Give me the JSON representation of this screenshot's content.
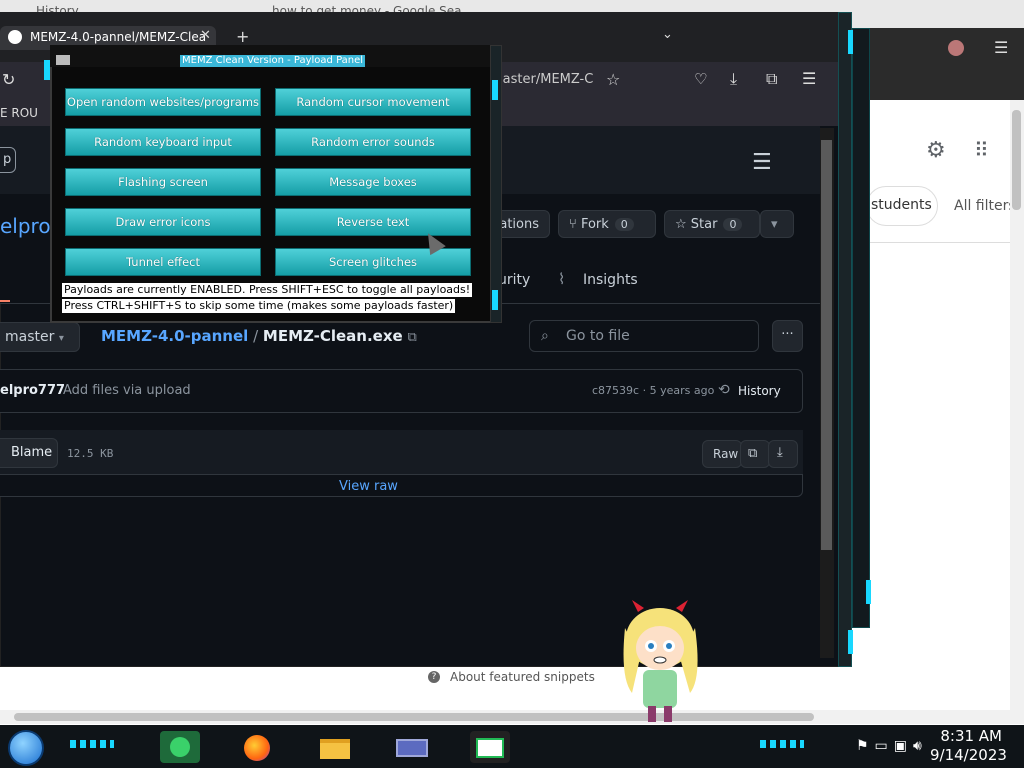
{
  "bg_browser": {
    "tabs": [
      "History",
      "how to get money - Google Search"
    ],
    "chips": [
      "students"
    ],
    "all_filters": "All filters",
    "about_snippets": "About featured snippets"
  },
  "gh": {
    "tab_title": "MEMZ-4.0-pannel/MEMZ-Clea",
    "url": "master/MEMZ-C",
    "bookmark": "E ROU",
    "repo_name_fragment": "elpro",
    "buttons": {
      "notifications": "cations",
      "fork": "Fork",
      "fork_count": "0",
      "star": "Star",
      "star_count": "0"
    },
    "tabs": [
      "urity",
      "Insights"
    ],
    "branch": "master",
    "path_repo": "MEMZ-4.0-pannel",
    "path_sep": "/",
    "path_file": "MEMZ-Clean.exe",
    "go_to_file": "Go to file",
    "commit_author": "elpro777",
    "commit_msg": "Add files via upload",
    "commit_hash": "c87539c · 5 years ago",
    "history": "History",
    "blame": "Blame",
    "size": "12.5 KB",
    "raw": "Raw",
    "view_raw": "View raw",
    "left_button_fragment": "p"
  },
  "memz": {
    "title": "MEMZ Clean Version - Payload Panel",
    "buttons": [
      "Open random websites/programs",
      "Random cursor movement",
      "Random keyboard input",
      "Random error sounds",
      "Flashing screen",
      "Message boxes",
      "Draw error icons",
      "Reverse text",
      "Tunnel effect",
      "Screen glitches"
    ],
    "note1": "Payloads are currently ENABLED. Press SHIFT+ESC to toggle all payloads!",
    "note2": "Press CTRL+SHIFT+S to skip some time (makes some payloads faster)"
  },
  "taskbar": {
    "time": "8:31 AM",
    "date": "9/14/2023"
  }
}
